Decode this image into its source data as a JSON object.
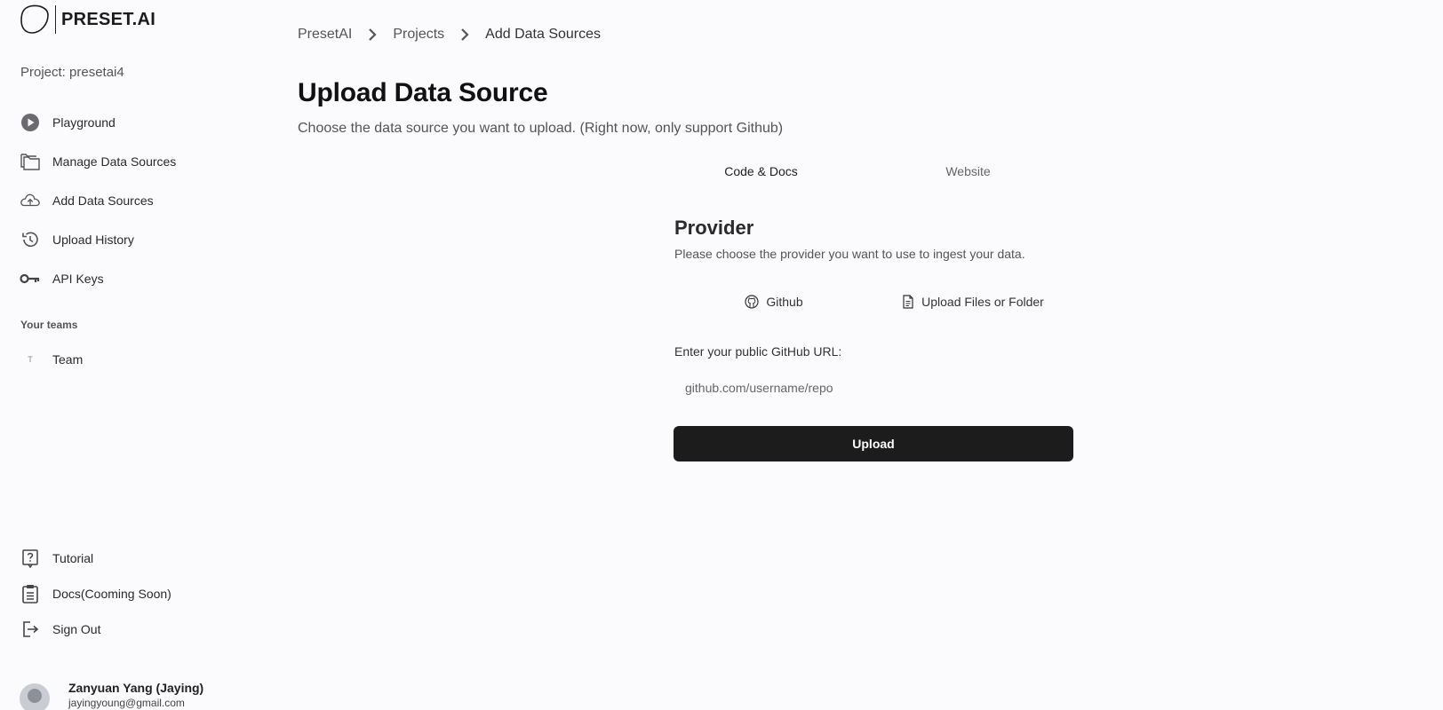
{
  "brand": {
    "name": "PRESET.AI"
  },
  "sidebar": {
    "project_label": "Project: presetai4",
    "nav": [
      {
        "label": "Playground",
        "icon": "play-circle-icon"
      },
      {
        "label": "Manage Data Sources",
        "icon": "folders-icon"
      },
      {
        "label": "Add Data Sources",
        "icon": "cloud-upload-icon"
      },
      {
        "label": "Upload History",
        "icon": "history-icon"
      },
      {
        "label": "API Keys",
        "icon": "key-icon"
      }
    ],
    "teams_heading": "Your teams",
    "teams": [
      {
        "initial": "T",
        "label": "Team"
      }
    ],
    "bottom_nav": [
      {
        "label": "Tutorial",
        "icon": "help-icon"
      },
      {
        "label": "Docs(Cooming Soon)",
        "icon": "clipboard-icon"
      },
      {
        "label": "Sign Out",
        "icon": "sign-out-icon"
      }
    ],
    "user": {
      "name": "Zanyuan Yang (Jaying)",
      "email": "jayingyoung@gmail.com"
    }
  },
  "breadcrumb": [
    "PresetAI",
    "Projects",
    "Add Data Sources"
  ],
  "main": {
    "title": "Upload Data Source",
    "subtitle": "Choose the data source you want to upload. (Right now, only support Github)",
    "tabs": [
      {
        "label": "Code & Docs",
        "active": true
      },
      {
        "label": "Website",
        "active": false
      }
    ],
    "provider": {
      "title": "Provider",
      "description": "Please choose the provider you want to use to ingest your data.",
      "options": [
        {
          "label": "Github",
          "icon": "github-icon"
        },
        {
          "label": "Upload Files or Folder",
          "icon": "file-icon"
        }
      ]
    },
    "url_label": "Enter your public GitHub URL:",
    "url_placeholder": "github.com/username/repo",
    "url_value": "",
    "upload_label": "Upload"
  },
  "colors": {
    "accent": "#1c1c1c",
    "background": "#fbfbfd",
    "muted_text": "#555555"
  }
}
